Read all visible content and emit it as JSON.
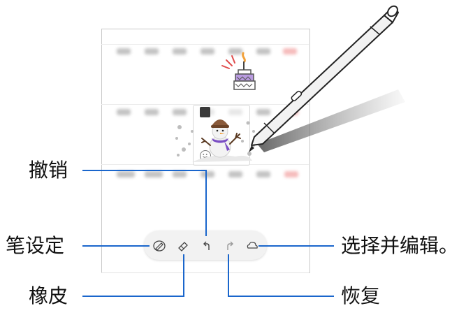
{
  "callouts": {
    "undo": "撤销",
    "pen_settings": "笔设定",
    "eraser": "橡皮",
    "redo": "恢复",
    "select_and_edit": "选择并编辑。"
  },
  "toolbar": {
    "items": [
      {
        "icon": "pen-settings-icon"
      },
      {
        "icon": "eraser-icon"
      },
      {
        "icon": "undo-icon"
      },
      {
        "icon": "redo-icon"
      },
      {
        "icon": "lasso-select-icon"
      }
    ]
  },
  "colors": {
    "callout_line": "#1a66cc",
    "pen_body": "#f6f6f6",
    "snowman_scarf": "#7b4fc4",
    "cake_accent": "#f2a13a"
  }
}
